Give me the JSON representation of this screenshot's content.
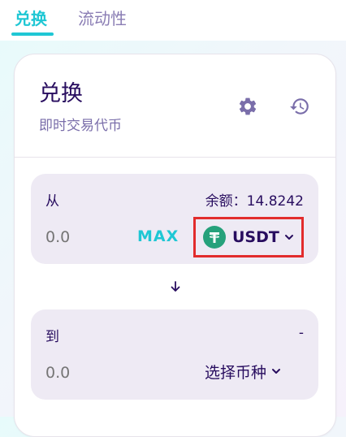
{
  "tabs": [
    {
      "label": "兑换",
      "active": true
    },
    {
      "label": "流动性",
      "active": false
    }
  ],
  "card": {
    "title": "兑换",
    "subtitle": "即时交易代币",
    "settings_icon": "gear-icon",
    "history_icon": "history-icon"
  },
  "from": {
    "label": "从",
    "balance": "余额：14.8242",
    "amount_placeholder": "0.0",
    "max_label": "MAX",
    "token": {
      "symbol": "USDT",
      "logo_color": "#26a17b",
      "icon": "tether-icon"
    }
  },
  "swap_icon": "arrow-down-icon",
  "to": {
    "label": "到",
    "balance": "-",
    "amount_placeholder": "0.0",
    "select_label": "选择币种"
  },
  "colors": {
    "accent": "#1fc7d4",
    "text_primary": "#280d5f",
    "text_secondary": "#7a6eaa",
    "highlight": "#e22c2c"
  }
}
